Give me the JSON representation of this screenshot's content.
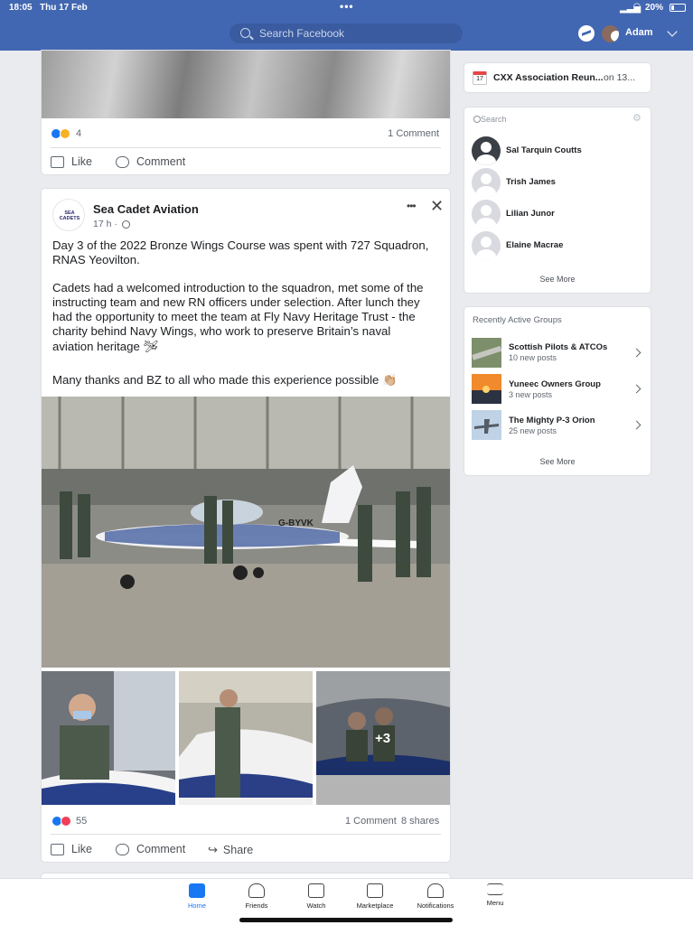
{
  "status": {
    "time": "18:05",
    "date": "Thu 17 Feb",
    "battery": "20%"
  },
  "header": {
    "search_placeholder": "Search Facebook",
    "user_name": "Adam"
  },
  "prev_post": {
    "reactions_count": "4",
    "comments": "1 Comment",
    "like": "Like",
    "comment": "Comment"
  },
  "post": {
    "page_name": "Sea Cadet Aviation",
    "time": "17 h ·",
    "logo_text": "SEA CADETS",
    "text_lines": [
      "Day 3 of the 2022 Bronze Wings Course was spent with 727 Squadron,",
      "RNAS Yeovilton.",
      "Cadets had a welcomed introduction to the squadron, met some of the",
      "instructing team and new RN officers under selection. After lunch they",
      "had the opportunity to meet the team at Fly Navy Heritage Trust - the",
      "charity behind Navy Wings, who work to preserve Britain’s naval",
      "aviation heritage 🛩",
      "Many thanks and BZ to all who made this experience possible 👏🏼"
    ],
    "plane_registration": "G-BYVK",
    "more_photos": "+3",
    "reactions_count": "55",
    "comments": "1 Comment",
    "shares": "8 shares",
    "like": "Like",
    "comment": "Comment",
    "share": "Share"
  },
  "sidebar": {
    "event": {
      "day": "17",
      "title": "CXX Association Reun...",
      "when": "on 13..."
    },
    "contacts_search": "Search",
    "contacts": [
      "Sal Tarquin Coutts",
      "Trish James",
      "Lilian Junor",
      "Elaine Macrae"
    ],
    "see_more": "See More",
    "groups_title": "Recently Active Groups",
    "groups": [
      {
        "name": "Scottish Pilots & ATCOs",
        "sub": "10 new posts"
      },
      {
        "name": "Yuneec Owners Group",
        "sub": "3 new posts"
      },
      {
        "name": "The Mighty P-3 Orion",
        "sub": "25 new posts"
      }
    ],
    "groups_see_more": "See More"
  },
  "nav": [
    "Home",
    "Friends",
    "Watch",
    "Marketplace",
    "Notifications",
    "Menu"
  ],
  "colors": {
    "brand": "#4267b2",
    "active": "#1877f2",
    "like": "#1877f2",
    "love": "#f33e58"
  }
}
